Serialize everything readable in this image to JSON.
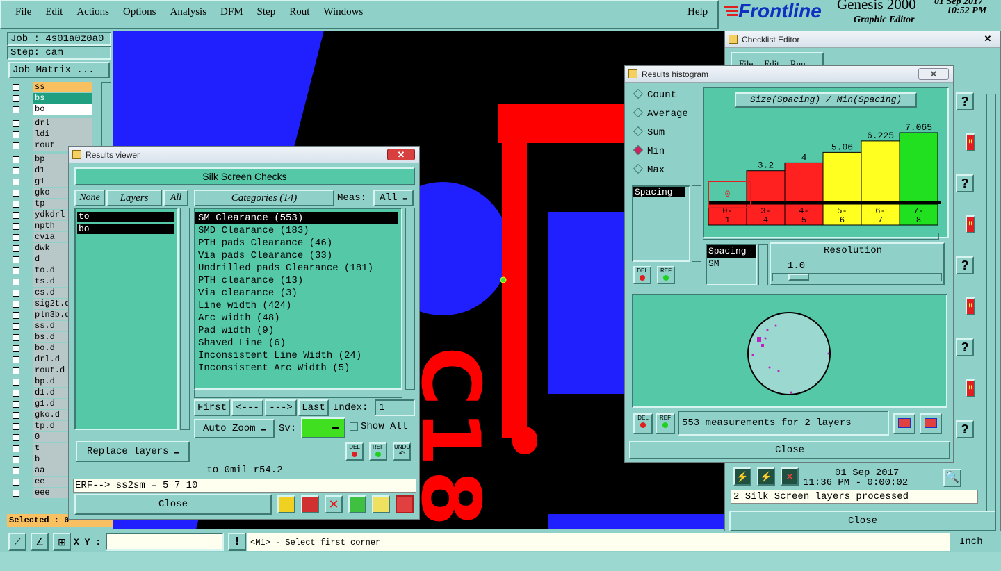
{
  "menu": [
    "File",
    "Edit",
    "Actions",
    "Options",
    "Analysis",
    "DFM",
    "Step",
    "Rout",
    "Windows"
  ],
  "help_label": "Help",
  "brand": {
    "logo": "Frontline",
    "product": "Genesis 2000",
    "subtitle": "Graphic Editor",
    "date": "01 Sep 2017",
    "time": "10:52 PM"
  },
  "left_panel": {
    "job": "Job : 4s01a0z0a0",
    "step": "Step: cam",
    "job_matrix": "Job Matrix ...",
    "layers": [
      "ss",
      "bs",
      "bo",
      "drl",
      "ldi",
      "rout",
      "bp",
      "d1",
      "g1",
      "gko",
      "tp",
      "ydkdrl",
      "npth",
      "cvia",
      "dwk",
      "d",
      "to.d",
      "ts.d",
      "cs.d",
      "sig2t.d",
      "pln3b.d",
      "ss.d",
      "bs.d",
      "bo.d",
      "drl.d",
      "rout.d",
      "bp.d",
      "d1.d",
      "g1.d",
      "gko.d",
      "tp.d",
      "0",
      "t",
      "b",
      "aa",
      "ee",
      "eee"
    ],
    "selected": "Selected : 0"
  },
  "canvas": {
    "text": "C18"
  },
  "results_viewer": {
    "title": "Results viewer",
    "header": "Silk Screen Checks",
    "none_btn": "None",
    "layers_label": "Layers",
    "all_btn": "All",
    "categories_label": "Categories (14)",
    "meas_label": "Meas:",
    "meas_value": "All",
    "layers": [
      "to",
      "bo"
    ],
    "categories": [
      "SM Clearance (553)",
      "SMD Clearance (183)",
      "PTH pads Clearance (46)",
      "Via pads Clearance (33)",
      "Undrilled pads Clearance (181)",
      "PTH clearance (13)",
      "Via clearance (3)",
      "Line width (424)",
      "Arc width (48)",
      "Pad width (9)",
      "Shaved Line (6)",
      "Inconsistent Line Width (24)",
      "Inconsistent Arc Width (5)"
    ],
    "first": "First",
    "prev": "<---",
    "next": "--->",
    "last": "Last",
    "index_label": "Index:",
    "index_value": "1",
    "auto_zoom": "Auto Zoom",
    "sv_label": "Sv:",
    "show_all": "Show All",
    "replace_layers": "Replace layers",
    "del": "DEL",
    "ref": "REF",
    "undo": "UNDO",
    "status": "to 0mil  r54.2",
    "erf": "ERF--> ss2sm = 5 7 10",
    "close": "Close"
  },
  "histogram": {
    "title": "Results histogram",
    "modes": [
      "Count",
      "Average",
      "Sum",
      "Min",
      "Max"
    ],
    "selected_mode": "Min",
    "chart_title": "Size(Spacing) / Min(Spacing)",
    "list_item": "Spacing",
    "res_list": [
      "Spacing",
      "SM"
    ],
    "resolution_label": "Resolution",
    "resolution_value": "1.0",
    "del": "DEL",
    "ref": "REF",
    "summary": "553 measurements for 2 layers",
    "close": "Close"
  },
  "chart_data": {
    "type": "bar",
    "title": "Size(Spacing) / Min(Spacing)",
    "categories": [
      "0-1",
      "3-4",
      "4-5",
      "5-6",
      "6-7",
      "7-8"
    ],
    "values": [
      0,
      3.2,
      4,
      5.06,
      6.225,
      7.065
    ],
    "labels": [
      "0",
      "3.2",
      "4",
      "5.06",
      "6.225",
      "7.065"
    ],
    "colors": [
      "#ff2020",
      "#ff2020",
      "#ff2020",
      "#ffff20",
      "#ffff20",
      "#20e020"
    ],
    "ylim": [
      0,
      7.065
    ]
  },
  "checklist": {
    "title": "Checklist Editor",
    "menu": [
      "File",
      "Edit",
      "Run"
    ],
    "date": "01 Sep 2017",
    "time": "11:36 PM - 0:00:02",
    "status": "2 Silk Screen layers processed",
    "close": "Close"
  },
  "bottom_bar": {
    "xy_label": "X Y :",
    "hint": "<M1> - Select first corner",
    "units": "Inch"
  },
  "colors": {
    "bg": "#8fd0c8",
    "teal": "#55c8a8",
    "canvas": "#000000",
    "accent_red": "#ff0000",
    "blue": "#2020ff"
  }
}
